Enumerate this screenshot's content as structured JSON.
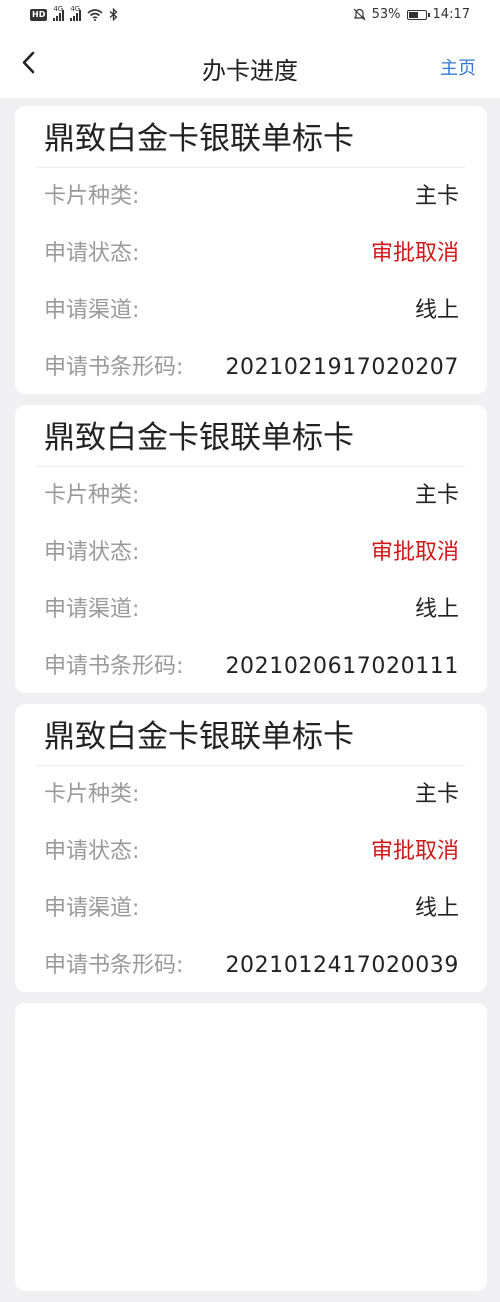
{
  "status_bar": {
    "hd": "HD",
    "signal1": "4G",
    "signal2": "4G",
    "battery_pct": "53%",
    "battery_level": 0.53,
    "time": "14:17",
    "icons": [
      "wifi-icon",
      "bluetooth-icon",
      "mute-icon",
      "battery-icon"
    ]
  },
  "nav": {
    "title": "办卡进度",
    "home": "主页",
    "back_icon": "chevron-left-icon"
  },
  "colors": {
    "accent": "#3478d0",
    "status_red": "#d01818",
    "background": "#f0f0f2"
  },
  "cards": [
    {
      "title": "鼎致白金卡银联单标卡",
      "rows": [
        {
          "label": "卡片种类:",
          "value": "主卡"
        },
        {
          "label": "申请状态:",
          "value": "审批取消"
        },
        {
          "label": "申请渠道:",
          "value": "线上"
        },
        {
          "label": "申请书条形码:",
          "value": "2021021917020207"
        }
      ]
    },
    {
      "title": "鼎致白金卡银联单标卡",
      "rows": [
        {
          "label": "卡片种类:",
          "value": "主卡"
        },
        {
          "label": "申请状态:",
          "value": "审批取消"
        },
        {
          "label": "申请渠道:",
          "value": "线上"
        },
        {
          "label": "申请书条形码:",
          "value": "2021020617020111"
        }
      ]
    },
    {
      "title": "鼎致白金卡银联单标卡",
      "rows": [
        {
          "label": "卡片种类:",
          "value": "主卡"
        },
        {
          "label": "申请状态:",
          "value": "审批取消"
        },
        {
          "label": "申请渠道:",
          "value": "线上"
        },
        {
          "label": "申请书条形码:",
          "value": "2021012417020039"
        }
      ]
    }
  ]
}
